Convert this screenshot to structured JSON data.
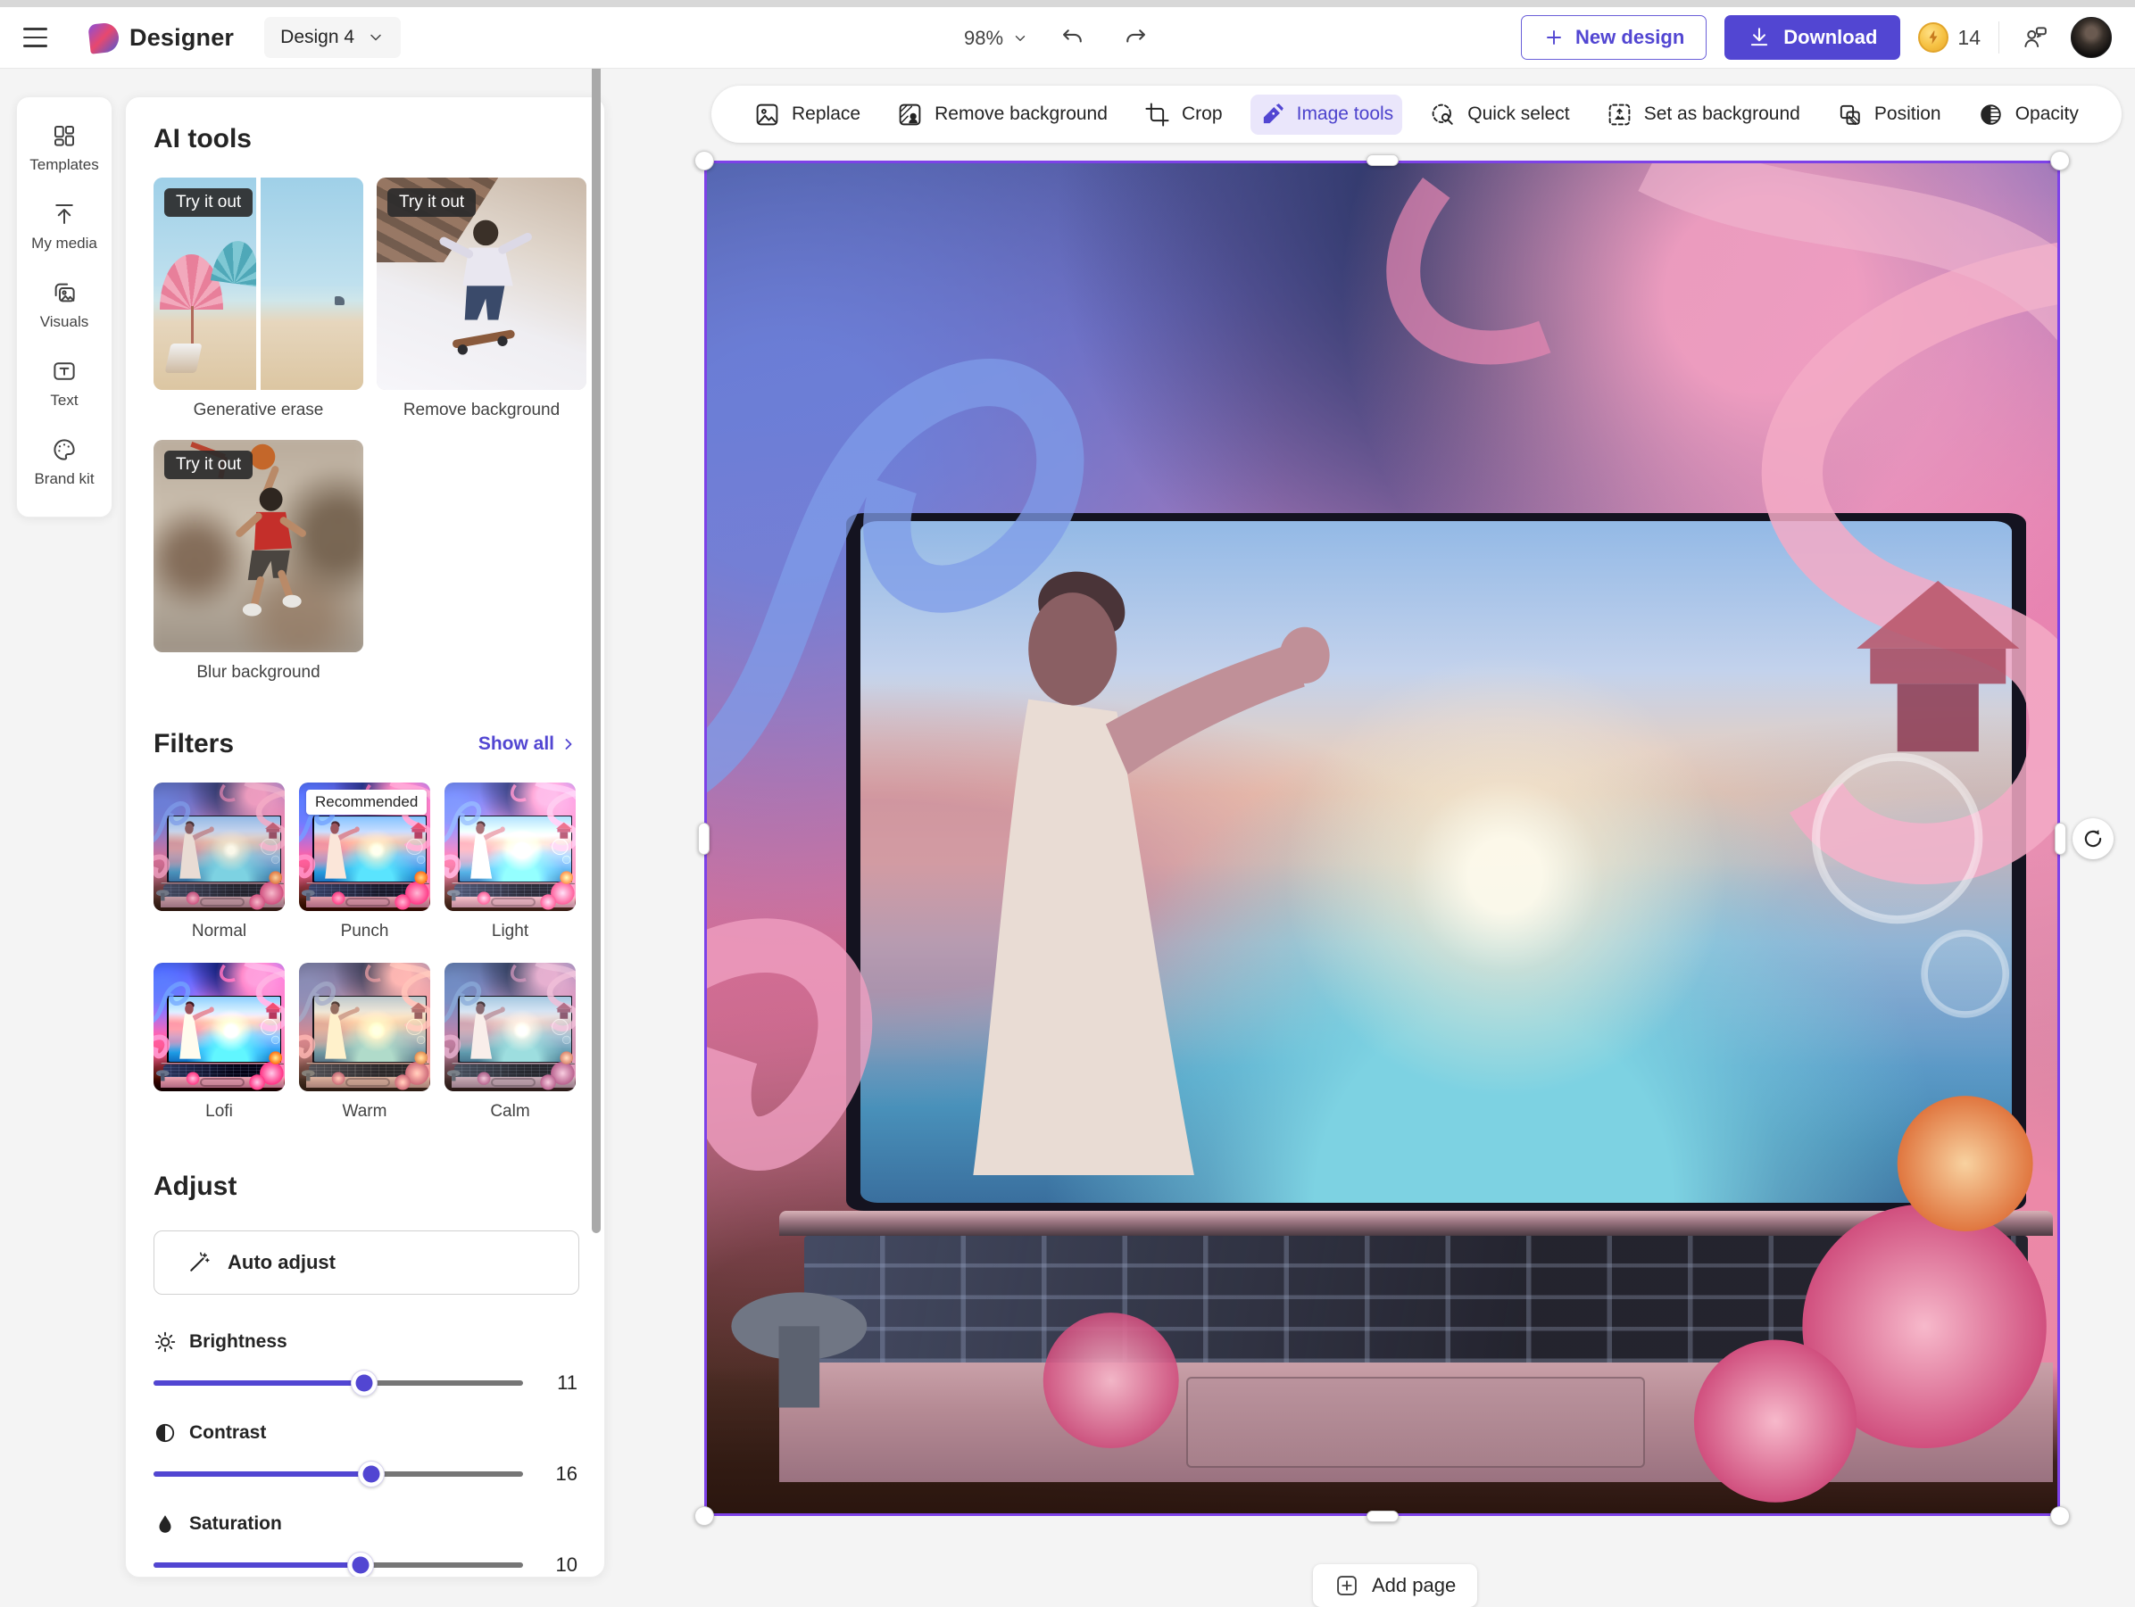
{
  "header": {
    "app_name": "Designer",
    "design_name": "Design 4",
    "zoom_level": "98%",
    "new_design_label": "New design",
    "download_label": "Download",
    "credits_count": "14"
  },
  "rail": {
    "items": [
      {
        "label": "Templates"
      },
      {
        "label": "My media"
      },
      {
        "label": "Visuals"
      },
      {
        "label": "Text"
      },
      {
        "label": "Brand kit"
      }
    ]
  },
  "panel": {
    "ai_tools": {
      "title": "AI tools",
      "try_badge": "Try it out",
      "tools": [
        {
          "label": "Generative erase"
        },
        {
          "label": "Remove background"
        },
        {
          "label": "Blur background"
        }
      ]
    },
    "filters": {
      "title": "Filters",
      "show_all": "Show all",
      "recommended_badge": "Recommended",
      "items": [
        {
          "label": "Normal"
        },
        {
          "label": "Punch"
        },
        {
          "label": "Light"
        },
        {
          "label": "Lofi"
        },
        {
          "label": "Warm"
        },
        {
          "label": "Calm"
        }
      ]
    },
    "adjust": {
      "title": "Adjust",
      "auto_adjust_label": "Auto adjust",
      "sliders": [
        {
          "label": "Brightness",
          "value": "11",
          "fill": "57%"
        },
        {
          "label": "Contrast",
          "value": "16",
          "fill": "59%"
        },
        {
          "label": "Saturation",
          "value": "10",
          "fill": "56%"
        }
      ]
    }
  },
  "toolbar": {
    "items": [
      {
        "label": "Replace",
        "active": false
      },
      {
        "label": "Remove background",
        "active": false
      },
      {
        "label": "Crop",
        "active": false
      },
      {
        "label": "Image tools",
        "active": true
      },
      {
        "label": "Quick select",
        "active": false
      },
      {
        "label": "Set as background",
        "active": false
      },
      {
        "label": "Position",
        "active": false
      },
      {
        "label": "Opacity",
        "active": false
      }
    ]
  },
  "canvas": {
    "add_page_label": "Add page"
  },
  "colors": {
    "accent": "#5246d2",
    "accent_light": "#eae6fb",
    "selection_border": "#7d41e8",
    "coin_gold": "#f6c244"
  }
}
